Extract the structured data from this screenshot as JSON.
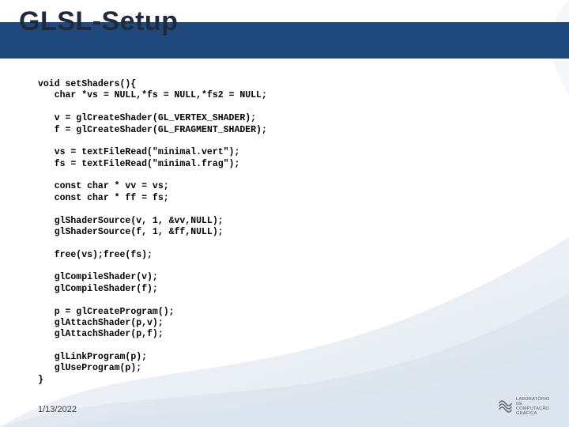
{
  "slide": {
    "title": "GLSL-Setup"
  },
  "code": {
    "line01": "void setShaders(){",
    "line02": "   char *vs = NULL,*fs = NULL,*fs2 = NULL;",
    "line03": "",
    "line04": "   v = glCreateShader(GL_VERTEX_SHADER);",
    "line05": "   f = glCreateShader(GL_FRAGMENT_SHADER);",
    "line06": "",
    "line07": "   vs = textFileRead(\"minimal.vert\");",
    "line08": "   fs = textFileRead(\"minimal.frag\");",
    "line09": "",
    "line10": "   const char * vv = vs;",
    "line11": "   const char * ff = fs;",
    "line12": "",
    "line13": "   glShaderSource(v, 1, &vv,NULL);",
    "line14": "   glShaderSource(f, 1, &ff,NULL);",
    "line15": "",
    "line16": "   free(vs);free(fs);",
    "line17": "",
    "line18": "   glCompileShader(v);",
    "line19": "   glCompileShader(f);",
    "line20": "",
    "line21": "   p = glCreateProgram();",
    "line22": "   glAttachShader(p,v);",
    "line23": "   glAttachShader(p,f);",
    "line24": "",
    "line25": "   glLinkProgram(p);",
    "line26": "   glUseProgram(p);",
    "line27": "}"
  },
  "footer": {
    "date": "1/13/2022",
    "logo_line1": "LABORATÓRIO",
    "logo_line2": "DE COMPUTAÇÃO",
    "logo_line3": "GRÁFICA"
  },
  "colors": {
    "title_bar": "#1f497d",
    "swoosh_light": "#e8edf3",
    "swoosh_mid": "#cfd9e6"
  }
}
